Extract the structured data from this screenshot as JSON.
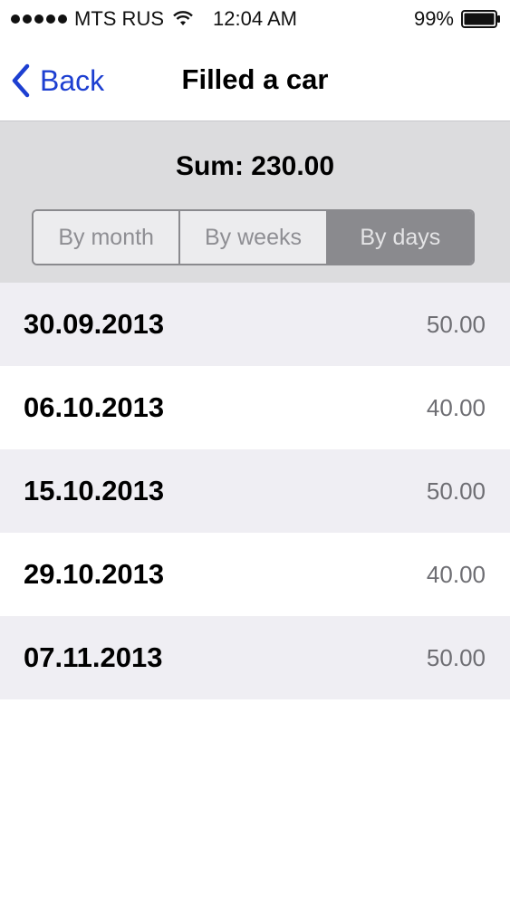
{
  "status_bar": {
    "carrier": "MTS RUS",
    "time": "12:04 AM",
    "battery": "99%",
    "icons": [
      "signal-icon",
      "wifi-icon",
      "battery-icon"
    ]
  },
  "nav": {
    "back_label": "Back",
    "title": "Filled a car",
    "accent_color": "#1d3fd1"
  },
  "summary": {
    "sum_label": "Sum: 230.00"
  },
  "segments": [
    {
      "label": "By month",
      "selected": false
    },
    {
      "label": "By weeks",
      "selected": false
    },
    {
      "label": "By days",
      "selected": true
    }
  ],
  "entries": [
    {
      "date": "30.09.2013",
      "amount": "50.00"
    },
    {
      "date": "06.10.2013",
      "amount": "40.00"
    },
    {
      "date": "15.10.2013",
      "amount": "50.00"
    },
    {
      "date": "29.10.2013",
      "amount": "40.00"
    },
    {
      "date": "07.11.2013",
      "amount": "50.00"
    }
  ]
}
